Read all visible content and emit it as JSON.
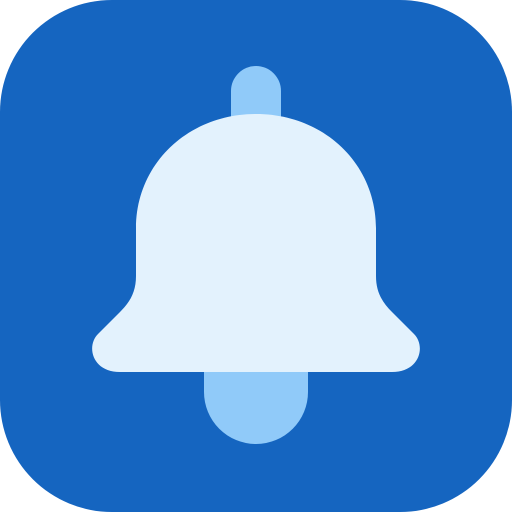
{
  "app_icon": {
    "icon_name": "bell-icon",
    "colors": {
      "tile_background": "#1565C0",
      "bell_body": "#E3F2FD",
      "bell_accent": "#90CAF9"
    }
  }
}
